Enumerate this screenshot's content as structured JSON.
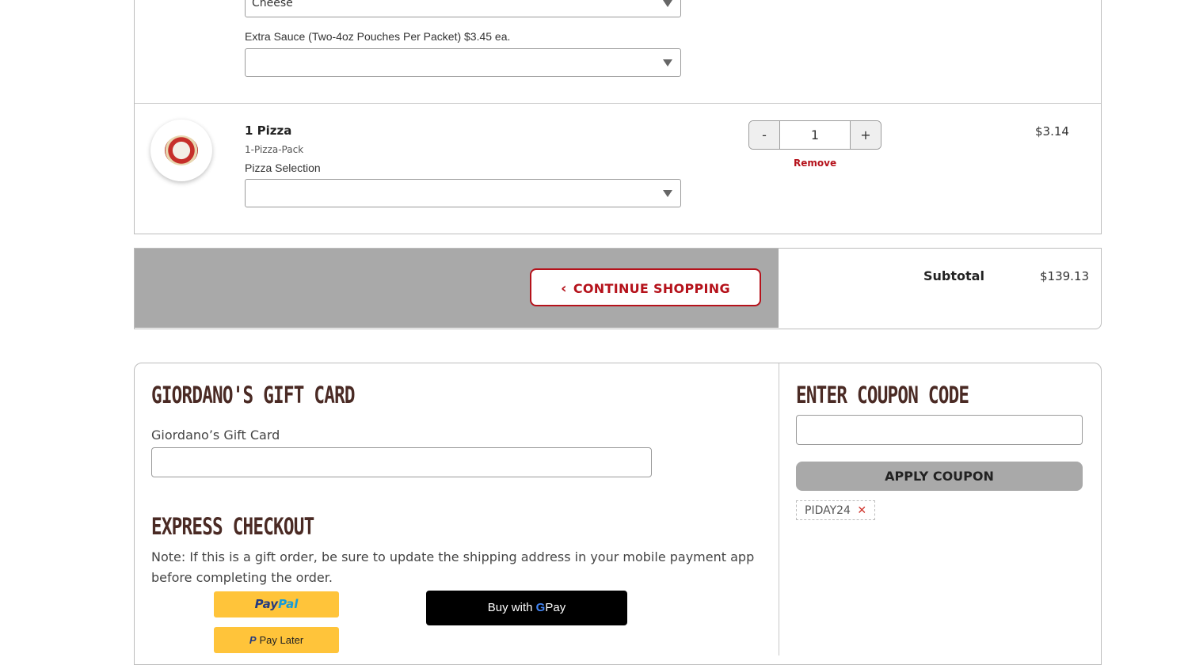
{
  "cart": {
    "prev_item": {
      "select_value": "Cheese",
      "extra_sauce_label": "Extra Sauce (Two-4oz Pouches Per Packet) $3.45 ea.",
      "extra_sauce_value": ""
    },
    "item": {
      "name": "1 Pizza",
      "subtitle": "1-Pizza-Pack",
      "selection_label": "Pizza Selection",
      "selection_value": "",
      "quantity": "1",
      "minus": "-",
      "plus": "+",
      "remove": "Remove",
      "price": "$3.14"
    }
  },
  "actions": {
    "continue_icon": "‹",
    "continue_label": "CONTINUE SHOPPING",
    "subtotal_label": "Subtotal",
    "subtotal_value": "$139.13"
  },
  "gift_card": {
    "heading": "GIORDANO'S GIFT CARD",
    "field_label": "Giordano’s Gift Card",
    "field_value": ""
  },
  "express": {
    "heading": "EXPRESS CHECKOUT",
    "note": "Note: If this is a gift order, be sure to update the shipping address in your mobile payment app before completing the order.",
    "paypal_pay": "Pay",
    "paypal_pal": "Pal",
    "paylater_label": "Pay Later",
    "gpay_prefix": "Buy with",
    "gpay_g": "G",
    "gpay_suffix": "Pay"
  },
  "coupon": {
    "heading": "ENTER COUPON CODE",
    "field_value": "",
    "apply_label": "APPLY COUPON",
    "applied_code": "PIDAY24",
    "remove_icon": "✕"
  },
  "colors": {
    "brand_red": "#b5121b",
    "heading_brown": "#4a2a24",
    "paypal_yellow": "#ffc43a"
  }
}
